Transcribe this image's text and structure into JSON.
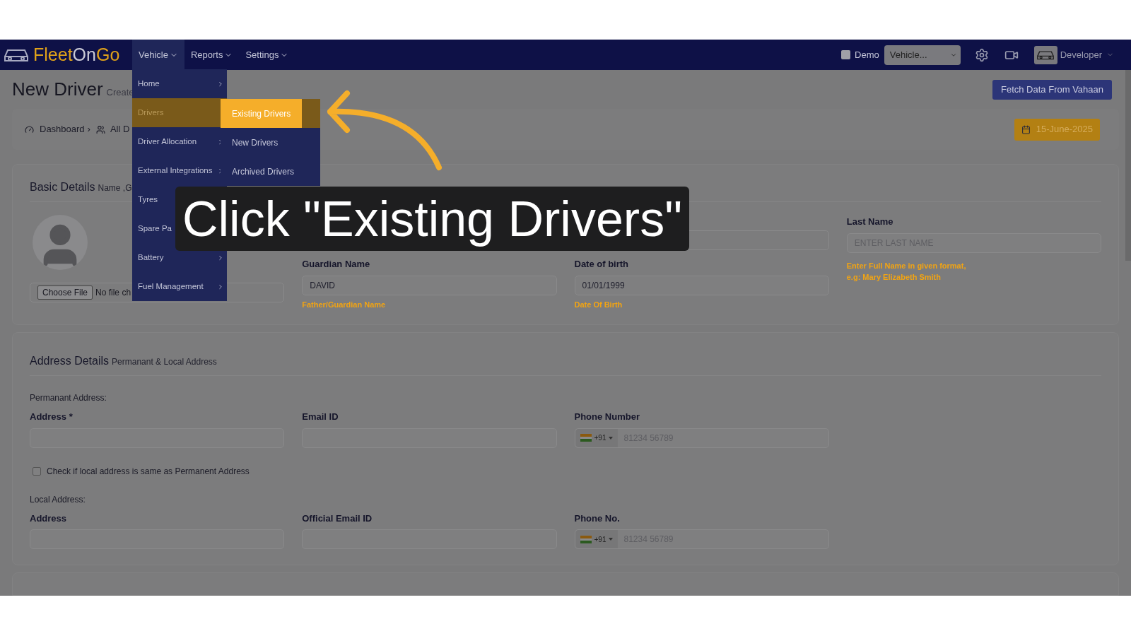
{
  "navbar": {
    "logo_parts": [
      {
        "text": "Fleet",
        "color": "#e0a21a"
      },
      {
        "text": "On",
        "color": "#c9c9d6"
      },
      {
        "text": "Go",
        "color": "#e0a21a"
      }
    ],
    "menus": [
      {
        "label": "Vehicle",
        "open": true
      },
      {
        "label": "Reports",
        "open": false
      },
      {
        "label": "Settings",
        "open": false
      }
    ],
    "demo": {
      "label": "Demo",
      "checked": false
    },
    "vehicle_select": {
      "value": "Vehicle..."
    },
    "user": "Developer"
  },
  "page": {
    "title": "New Driver",
    "subtitle": "Create",
    "fetch_button": "Fetch Data From Vahaan",
    "breadcrumb": [
      "Dashboard",
      "All D"
    ],
    "breadcrumb_separator": "›",
    "date": "15-June-2025"
  },
  "basic_details": {
    "title": "Basic Details",
    "subtitle": "Name ,G",
    "file_button": "Choose File",
    "file_status": "No file ch",
    "fields": [
      {
        "label": "Guardian Name",
        "value": "DAVID",
        "hint": "Father/Guardian Name"
      },
      {
        "label": "Date of birth",
        "value": "01/01/1999",
        "hint": "Date Of Birth"
      }
    ],
    "last_name": {
      "label": "Last Name",
      "placeholder": "ENTER LAST NAME",
      "hint": "Enter Full Name in given format, e.g: Mary Elizabeth Smith"
    }
  },
  "address_details": {
    "title": "Address Details",
    "subtitle": "Permanant & Local Address",
    "permanent": {
      "heading": "Permanant Address:",
      "address_label": "Address *",
      "email_label": "Email ID",
      "phone_label": "Phone Number",
      "code": "+91",
      "phone_placeholder": "81234 56789"
    },
    "same_checkbox": {
      "label": "Check if local address is same as Permanent Address",
      "checked": false
    },
    "local": {
      "heading": "Local Address:",
      "address_label": "Address",
      "email_label": "Official Email ID",
      "phone_label": "Phone No.",
      "code": "+91",
      "phone_placeholder": "81234 56789"
    }
  },
  "dropdown": {
    "items": [
      {
        "label": "Home",
        "submenu": true,
        "selected": false
      },
      {
        "label": "Drivers",
        "submenu": false,
        "selected": true
      },
      {
        "label": "Driver Allocation",
        "submenu": true,
        "selected": false
      },
      {
        "label": "External Integrations",
        "submenu": true,
        "selected": false
      },
      {
        "label": "Tyres",
        "selected": false
      },
      {
        "label": "Spare Pa",
        "selected": false
      },
      {
        "label": "Battery",
        "submenu": true,
        "selected": false
      },
      {
        "label": "Fuel Management",
        "submenu": true,
        "selected": false
      }
    ],
    "submenu": [
      {
        "label": "Existing Drivers",
        "selected": true
      },
      {
        "label": "New Drivers",
        "selected": false
      },
      {
        "label": "Archived Drivers",
        "selected": false
      }
    ]
  },
  "caption": "Click \"Existing Drivers\""
}
